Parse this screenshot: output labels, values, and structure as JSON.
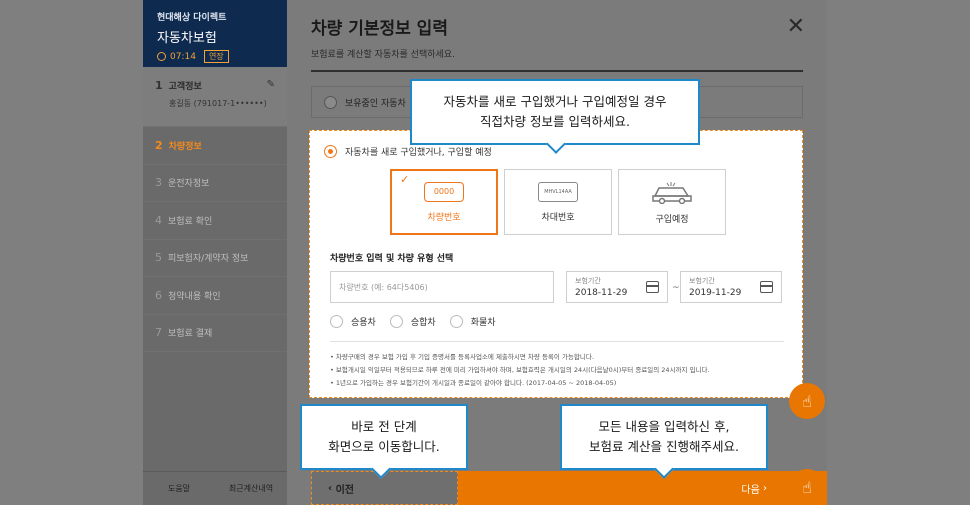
{
  "brand": {
    "company": "현대해상 다이렉트",
    "product": "자동차보험",
    "timer": "07:14",
    "extend_label": "연장"
  },
  "steps": [
    {
      "num": "1",
      "label": "고객정보",
      "detail": "홍길동 (791017-1••••••)"
    },
    {
      "num": "2",
      "label": "차량정보"
    },
    {
      "num": "3",
      "label": "운전자정보"
    },
    {
      "num": "4",
      "label": "보험료 확인"
    },
    {
      "num": "5",
      "label": "피보험자/계약자 정보"
    },
    {
      "num": "6",
      "label": "청약내용 확인"
    },
    {
      "num": "7",
      "label": "보험료 결제"
    }
  ],
  "sidebar_footer": {
    "help": "도움말",
    "recent": "최근계산내역"
  },
  "header": {
    "title": "차량 기본정보 입력",
    "subtitle": "보험료를 계산할 자동차를 선택하세요."
  },
  "owned_option": "보유중인 자동차",
  "new_option": "자동차를 새로 구입했거나, 구입할 예정",
  "cards": [
    {
      "icon_text": "0000",
      "label": "차량번호"
    },
    {
      "icon_text": "MHVL14AA",
      "label": "차대번호"
    },
    {
      "label": "구입예정"
    }
  ],
  "section_title": "차량번호 입력 및 차량 유형 선택",
  "plate_placeholder": "차량번호 (예: 64다5406)",
  "period": {
    "label": "보험기간",
    "start": "2018-11-29",
    "end": "2019-11-29",
    "tilde": "~"
  },
  "vehicle_types": [
    "승용차",
    "승합차",
    "화물차"
  ],
  "notes": [
    "• 차량구매의 경우 보험 가입 후 기입 증명서를 등록사업소에 제출하시면 차량 등록이 가능합니다.",
    "• 보험개시일 익일부터 적용되므로 하루 전에 미리 가입하셔야 하며, 보험효력은 개시일의 24시(다음날0시)부터 종료일의 24시까지 입니다.",
    "• 1년으로 가입하는 경우 보험기간이 개시일과 종료일이 같아야 합니다. (2017-04-05 ~ 2018-04-05)"
  ],
  "nav": {
    "prev": "이전",
    "next": "다음"
  },
  "tooltips": {
    "tip1_line1": "자동차를 새로 구입했거나 구입예정일 경우",
    "tip1_line2": "직접차량 정보를 입력하세요.",
    "tip2_line1": "바로 전 단계",
    "tip2_line2": "화면으로 이동합니다.",
    "tip3_line1": "모든 내용을 입력하신 후,",
    "tip3_line2": "보험료 계산을 진행해주세요."
  },
  "colors": {
    "accent": "#e87600",
    "tooltip_border": "#1e88c9",
    "brand_bg": "#0e2a4f"
  }
}
